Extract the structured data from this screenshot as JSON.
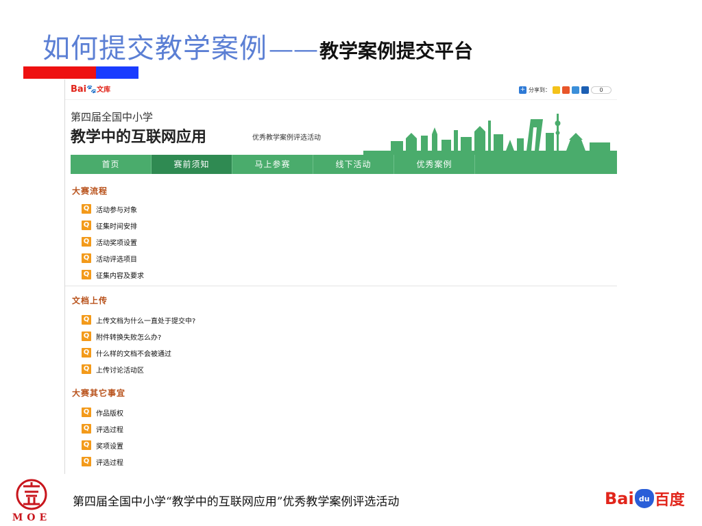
{
  "slide": {
    "title": "如何提交教学案例",
    "dash": "——",
    "subtitle": "教学案例提交平台",
    "footer": "第四届全国中小学“教学中的互联网应用”优秀教学案例评选活动",
    "moe_text": "MOE",
    "baidu_logo": {
      "left": "Bai",
      "mark": "du",
      "right": "百度"
    }
  },
  "web": {
    "logo": {
      "bai": "Bai",
      "paw": "du",
      "wenku": "文库"
    },
    "share": {
      "label": "分享到：",
      "count": "0",
      "icons": [
        "qzone-icon",
        "sina-icon",
        "renren-icon",
        "douban-icon"
      ]
    },
    "banner": {
      "superscript": "第四届全国中小学",
      "title": "教学中的互联网应用",
      "tagline": "优秀教学案例评选活动"
    },
    "nav": [
      {
        "label": "首页",
        "active": false
      },
      {
        "label": "赛前须知",
        "active": true
      },
      {
        "label": "马上参赛",
        "active": false
      },
      {
        "label": "线下活动",
        "active": false
      },
      {
        "label": "优秀案例",
        "active": false
      }
    ],
    "sections": [
      {
        "heading": "大赛流程",
        "items": [
          "活动参与对象",
          "征集时间安排",
          "活动奖项设置",
          "活动评选项目",
          "征集内容及要求"
        ]
      },
      {
        "heading": "文档上传",
        "items": [
          "上传文档为什么一直处于提交中?",
          "附件转换失败怎么办?",
          "什么样的文档不会被通过",
          "上传讨论活动区"
        ]
      },
      {
        "heading": "大赛其它事宜",
        "items": [
          "作品版权",
          "评选过程",
          "奖项设置",
          "评选过程"
        ]
      }
    ],
    "colors": {
      "nav": "#4aac6c",
      "nav_active": "#2f8a52",
      "heading": "#b8511a",
      "q_icon": "#f39a1a"
    }
  }
}
